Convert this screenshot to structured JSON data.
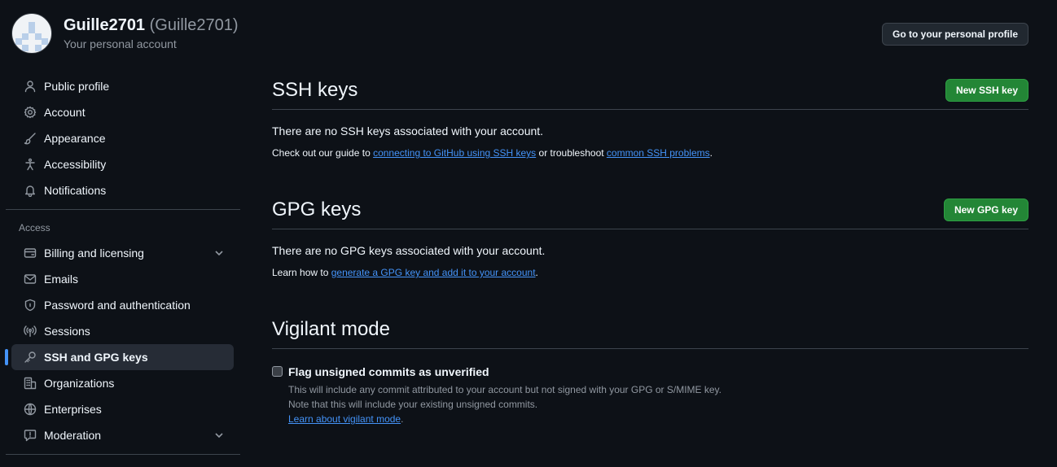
{
  "header": {
    "display_name": "Guille2701",
    "login": "(Guille2701)",
    "subtitle": "Your personal account",
    "profile_button": "Go to your personal profile"
  },
  "sidebar": {
    "items": [
      {
        "label": "Public profile",
        "icon": "person-icon"
      },
      {
        "label": "Account",
        "icon": "gear-icon"
      },
      {
        "label": "Appearance",
        "icon": "paintbrush-icon"
      },
      {
        "label": "Accessibility",
        "icon": "accessibility-icon"
      },
      {
        "label": "Notifications",
        "icon": "bell-icon"
      }
    ],
    "access_label": "Access",
    "access_items": [
      {
        "label": "Billing and licensing",
        "icon": "credit-card-icon",
        "expandable": true
      },
      {
        "label": "Emails",
        "icon": "mail-icon"
      },
      {
        "label": "Password and authentication",
        "icon": "shield-lock-icon"
      },
      {
        "label": "Sessions",
        "icon": "broadcast-icon"
      },
      {
        "label": "SSH and GPG keys",
        "icon": "key-icon",
        "active": true
      },
      {
        "label": "Organizations",
        "icon": "organization-icon"
      },
      {
        "label": "Enterprises",
        "icon": "globe-icon"
      },
      {
        "label": "Moderation",
        "icon": "report-icon",
        "expandable": true
      }
    ]
  },
  "ssh": {
    "title": "SSH keys",
    "button": "New SSH key",
    "empty": "There are no SSH keys associated with your account.",
    "note_prefix": "Check out our guide to ",
    "link1": "connecting to GitHub using SSH keys",
    "note_middle": " or troubleshoot ",
    "link2": "common SSH problems",
    "note_suffix": "."
  },
  "gpg": {
    "title": "GPG keys",
    "button": "New GPG key",
    "empty": "There are no GPG keys associated with your account.",
    "note_prefix": "Learn how to ",
    "link1": "generate a GPG key and add it to your account",
    "note_suffix": "."
  },
  "vigilant": {
    "title": "Vigilant mode",
    "checkbox_label": "Flag unsigned commits as unverified",
    "checked": false,
    "desc1": "This will include any commit attributed to your account but not signed with your GPG or S/MIME key.",
    "desc2": "Note that this will include your existing unsigned commits.",
    "link": "Learn about vigilant mode",
    "link_suffix": "."
  },
  "colors": {
    "background": "#0d1117",
    "accent": "#4493f8",
    "green_button": "#238636"
  }
}
